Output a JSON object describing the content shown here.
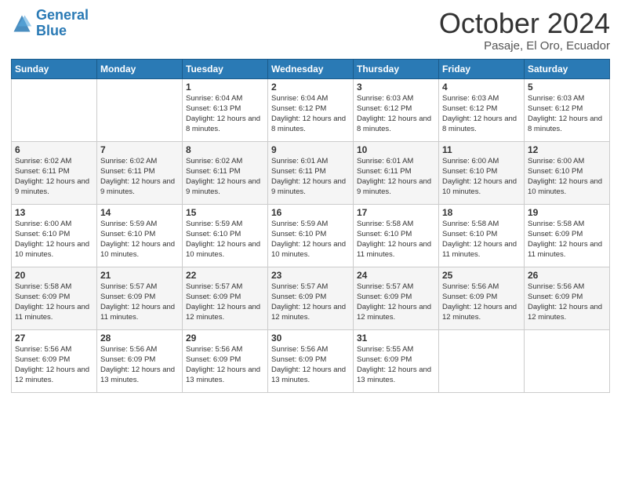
{
  "header": {
    "logo_line1": "General",
    "logo_line2": "Blue",
    "month_title": "October 2024",
    "location": "Pasaje, El Oro, Ecuador"
  },
  "days_of_week": [
    "Sunday",
    "Monday",
    "Tuesday",
    "Wednesday",
    "Thursday",
    "Friday",
    "Saturday"
  ],
  "weeks": [
    [
      {
        "day": "",
        "info": ""
      },
      {
        "day": "",
        "info": ""
      },
      {
        "day": "1",
        "info": "Sunrise: 6:04 AM\nSunset: 6:13 PM\nDaylight: 12 hours and 8 minutes."
      },
      {
        "day": "2",
        "info": "Sunrise: 6:04 AM\nSunset: 6:12 PM\nDaylight: 12 hours and 8 minutes."
      },
      {
        "day": "3",
        "info": "Sunrise: 6:03 AM\nSunset: 6:12 PM\nDaylight: 12 hours and 8 minutes."
      },
      {
        "day": "4",
        "info": "Sunrise: 6:03 AM\nSunset: 6:12 PM\nDaylight: 12 hours and 8 minutes."
      },
      {
        "day": "5",
        "info": "Sunrise: 6:03 AM\nSunset: 6:12 PM\nDaylight: 12 hours and 8 minutes."
      }
    ],
    [
      {
        "day": "6",
        "info": "Sunrise: 6:02 AM\nSunset: 6:11 PM\nDaylight: 12 hours and 9 minutes."
      },
      {
        "day": "7",
        "info": "Sunrise: 6:02 AM\nSunset: 6:11 PM\nDaylight: 12 hours and 9 minutes."
      },
      {
        "day": "8",
        "info": "Sunrise: 6:02 AM\nSunset: 6:11 PM\nDaylight: 12 hours and 9 minutes."
      },
      {
        "day": "9",
        "info": "Sunrise: 6:01 AM\nSunset: 6:11 PM\nDaylight: 12 hours and 9 minutes."
      },
      {
        "day": "10",
        "info": "Sunrise: 6:01 AM\nSunset: 6:11 PM\nDaylight: 12 hours and 9 minutes."
      },
      {
        "day": "11",
        "info": "Sunrise: 6:00 AM\nSunset: 6:10 PM\nDaylight: 12 hours and 10 minutes."
      },
      {
        "day": "12",
        "info": "Sunrise: 6:00 AM\nSunset: 6:10 PM\nDaylight: 12 hours and 10 minutes."
      }
    ],
    [
      {
        "day": "13",
        "info": "Sunrise: 6:00 AM\nSunset: 6:10 PM\nDaylight: 12 hours and 10 minutes."
      },
      {
        "day": "14",
        "info": "Sunrise: 5:59 AM\nSunset: 6:10 PM\nDaylight: 12 hours and 10 minutes."
      },
      {
        "day": "15",
        "info": "Sunrise: 5:59 AM\nSunset: 6:10 PM\nDaylight: 12 hours and 10 minutes."
      },
      {
        "day": "16",
        "info": "Sunrise: 5:59 AM\nSunset: 6:10 PM\nDaylight: 12 hours and 10 minutes."
      },
      {
        "day": "17",
        "info": "Sunrise: 5:58 AM\nSunset: 6:10 PM\nDaylight: 12 hours and 11 minutes."
      },
      {
        "day": "18",
        "info": "Sunrise: 5:58 AM\nSunset: 6:10 PM\nDaylight: 12 hours and 11 minutes."
      },
      {
        "day": "19",
        "info": "Sunrise: 5:58 AM\nSunset: 6:09 PM\nDaylight: 12 hours and 11 minutes."
      }
    ],
    [
      {
        "day": "20",
        "info": "Sunrise: 5:58 AM\nSunset: 6:09 PM\nDaylight: 12 hours and 11 minutes."
      },
      {
        "day": "21",
        "info": "Sunrise: 5:57 AM\nSunset: 6:09 PM\nDaylight: 12 hours and 11 minutes."
      },
      {
        "day": "22",
        "info": "Sunrise: 5:57 AM\nSunset: 6:09 PM\nDaylight: 12 hours and 12 minutes."
      },
      {
        "day": "23",
        "info": "Sunrise: 5:57 AM\nSunset: 6:09 PM\nDaylight: 12 hours and 12 minutes."
      },
      {
        "day": "24",
        "info": "Sunrise: 5:57 AM\nSunset: 6:09 PM\nDaylight: 12 hours and 12 minutes."
      },
      {
        "day": "25",
        "info": "Sunrise: 5:56 AM\nSunset: 6:09 PM\nDaylight: 12 hours and 12 minutes."
      },
      {
        "day": "26",
        "info": "Sunrise: 5:56 AM\nSunset: 6:09 PM\nDaylight: 12 hours and 12 minutes."
      }
    ],
    [
      {
        "day": "27",
        "info": "Sunrise: 5:56 AM\nSunset: 6:09 PM\nDaylight: 12 hours and 12 minutes."
      },
      {
        "day": "28",
        "info": "Sunrise: 5:56 AM\nSunset: 6:09 PM\nDaylight: 12 hours and 13 minutes."
      },
      {
        "day": "29",
        "info": "Sunrise: 5:56 AM\nSunset: 6:09 PM\nDaylight: 12 hours and 13 minutes."
      },
      {
        "day": "30",
        "info": "Sunrise: 5:56 AM\nSunset: 6:09 PM\nDaylight: 12 hours and 13 minutes."
      },
      {
        "day": "31",
        "info": "Sunrise: 5:55 AM\nSunset: 6:09 PM\nDaylight: 12 hours and 13 minutes."
      },
      {
        "day": "",
        "info": ""
      },
      {
        "day": "",
        "info": ""
      }
    ]
  ]
}
